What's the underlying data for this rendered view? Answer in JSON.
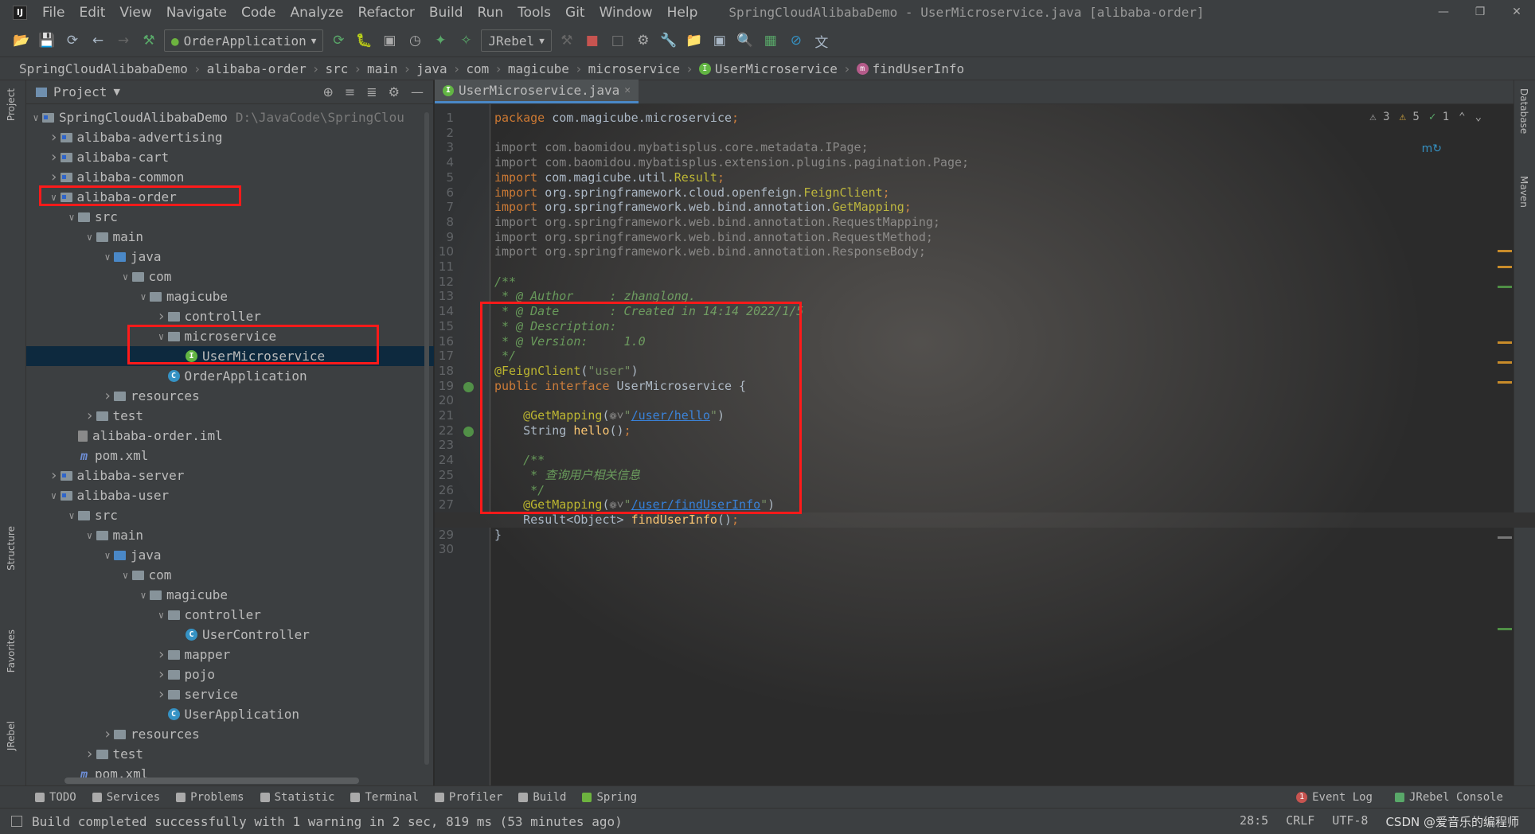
{
  "window": {
    "menu": [
      "File",
      "Edit",
      "View",
      "Navigate",
      "Code",
      "Analyze",
      "Refactor",
      "Build",
      "Run",
      "Tools",
      "Git",
      "Window",
      "Help"
    ],
    "title": "SpringCloudAlibabaDemo - UserMicroservice.java [alibaba-order]"
  },
  "toolbar": {
    "run_config": "OrderApplication",
    "jrebel": "JRebel"
  },
  "breadcrumb": [
    "SpringCloudAlibabaDemo",
    "alibaba-order",
    "src",
    "main",
    "java",
    "com",
    "magicube",
    "microservice",
    "UserMicroservice",
    "findUserInfo"
  ],
  "side_labels": {
    "project": "Project",
    "structure": "Structure",
    "favorites": "Favorites",
    "jrebel": "JRebel",
    "database": "Database",
    "maven": "Maven"
  },
  "project_panel": {
    "title": "Project",
    "root_path": "D:\\JavaCode\\SpringClou",
    "tree": [
      {
        "label": "SpringCloudAlibabaDemo",
        "depth": 0,
        "arrow": "v",
        "type": "module"
      },
      {
        "label": "alibaba-advertising",
        "depth": 1,
        "arrow": ">",
        "type": "module"
      },
      {
        "label": "alibaba-cart",
        "depth": 1,
        "arrow": ">",
        "type": "module"
      },
      {
        "label": "alibaba-common",
        "depth": 1,
        "arrow": ">",
        "type": "module"
      },
      {
        "label": "alibaba-order",
        "depth": 1,
        "arrow": "v",
        "type": "module"
      },
      {
        "label": "src",
        "depth": 2,
        "arrow": "v",
        "type": "folder"
      },
      {
        "label": "main",
        "depth": 3,
        "arrow": "v",
        "type": "folder"
      },
      {
        "label": "java",
        "depth": 4,
        "arrow": "v",
        "type": "srcfolder"
      },
      {
        "label": "com",
        "depth": 5,
        "arrow": "v",
        "type": "folder"
      },
      {
        "label": "magicube",
        "depth": 6,
        "arrow": "v",
        "type": "folder"
      },
      {
        "label": "controller",
        "depth": 7,
        "arrow": ">",
        "type": "folder"
      },
      {
        "label": "microservice",
        "depth": 7,
        "arrow": "v",
        "type": "folder"
      },
      {
        "label": "UserMicroservice",
        "depth": 8,
        "arrow": "",
        "type": "interface",
        "selected": true
      },
      {
        "label": "OrderApplication",
        "depth": 7,
        "arrow": "",
        "type": "springclass"
      },
      {
        "label": "resources",
        "depth": 4,
        "arrow": ">",
        "type": "folder"
      },
      {
        "label": "test",
        "depth": 3,
        "arrow": ">",
        "type": "folder"
      },
      {
        "label": "alibaba-order.iml",
        "depth": 2,
        "arrow": "",
        "type": "iml"
      },
      {
        "label": "pom.xml",
        "depth": 2,
        "arrow": "",
        "type": "maven"
      },
      {
        "label": "alibaba-server",
        "depth": 1,
        "arrow": ">",
        "type": "module"
      },
      {
        "label": "alibaba-user",
        "depth": 1,
        "arrow": "v",
        "type": "module"
      },
      {
        "label": "src",
        "depth": 2,
        "arrow": "v",
        "type": "folder"
      },
      {
        "label": "main",
        "depth": 3,
        "arrow": "v",
        "type": "folder"
      },
      {
        "label": "java",
        "depth": 4,
        "arrow": "v",
        "type": "srcfolder"
      },
      {
        "label": "com",
        "depth": 5,
        "arrow": "v",
        "type": "folder"
      },
      {
        "label": "magicube",
        "depth": 6,
        "arrow": "v",
        "type": "folder"
      },
      {
        "label": "controller",
        "depth": 7,
        "arrow": "v",
        "type": "folder"
      },
      {
        "label": "UserController",
        "depth": 8,
        "arrow": "",
        "type": "class"
      },
      {
        "label": "mapper",
        "depth": 7,
        "arrow": ">",
        "type": "folder"
      },
      {
        "label": "pojo",
        "depth": 7,
        "arrow": ">",
        "type": "folder"
      },
      {
        "label": "service",
        "depth": 7,
        "arrow": ">",
        "type": "folder"
      },
      {
        "label": "UserApplication",
        "depth": 7,
        "arrow": "",
        "type": "springclass"
      },
      {
        "label": "resources",
        "depth": 4,
        "arrow": ">",
        "type": "folder"
      },
      {
        "label": "test",
        "depth": 3,
        "arrow": ">",
        "type": "folder"
      },
      {
        "label": "pom.xml",
        "depth": 2,
        "arrow": "",
        "type": "maven"
      }
    ]
  },
  "editor": {
    "tab": "UserMicroservice.java",
    "inspections": {
      "warn_a": "3",
      "warn_b": "5",
      "ok": "1"
    },
    "current_line": 28,
    "lines": [
      [
        [
          "kw",
          "package "
        ],
        [
          "cls",
          "com.magicube.microservice"
        ],
        [
          "kw",
          ";"
        ]
      ],
      [],
      [
        [
          "gray",
          "import com.baomidou.mybatisplus.core.metadata.IPage;"
        ]
      ],
      [
        [
          "gray",
          "import com.baomidou.mybatisplus.extension.plugins.pagination.Page;"
        ]
      ],
      [
        [
          "kw",
          "import "
        ],
        [
          "cls",
          "com.magicube.util."
        ],
        [
          "ann",
          "Result"
        ],
        [
          "kw",
          ";"
        ]
      ],
      [
        [
          "kw",
          "import "
        ],
        [
          "cls",
          "org.springframework.cloud.openfeign."
        ],
        [
          "ann",
          "FeignClient"
        ],
        [
          "kw",
          ";"
        ]
      ],
      [
        [
          "kw",
          "import "
        ],
        [
          "cls",
          "org.springframework.web.bind.annotation."
        ],
        [
          "ann",
          "GetMapping"
        ],
        [
          "kw",
          ";"
        ]
      ],
      [
        [
          "gray",
          "import org.springframework.web.bind.annotation.RequestMapping;"
        ]
      ],
      [
        [
          "gray",
          "import org.springframework.web.bind.annotation.RequestMethod;"
        ]
      ],
      [
        [
          "gray",
          "import org.springframework.web.bind.annotation.ResponseBody;"
        ]
      ],
      [],
      [
        [
          "com",
          "/**"
        ]
      ],
      [
        [
          "com",
          " * @ Author     : "
        ],
        [
          "com",
          "zhanglong"
        ],
        [
          "com",
          "."
        ]
      ],
      [
        [
          "com",
          " * @ Date       : Created in 14:14 2022/1/5"
        ]
      ],
      [
        [
          "com",
          " * @ Description:"
        ]
      ],
      [
        [
          "com",
          " * @ Version:     1.0"
        ]
      ],
      [
        [
          "com",
          " */"
        ]
      ],
      [
        [
          "ann",
          "@FeignClient"
        ],
        [
          "cls",
          "("
        ],
        [
          "str",
          "\"user\""
        ],
        [
          "cls",
          ")"
        ]
      ],
      [
        [
          "kw",
          "public interface "
        ],
        [
          "cls",
          "UserMicroservice {"
        ]
      ],
      [],
      [
        [
          "ann",
          "    @GetMapping"
        ],
        [
          "cls",
          "("
        ],
        [
          "gray",
          "❁˅"
        ],
        [
          "str",
          "\""
        ],
        [
          "url",
          "/user/hello"
        ],
        [
          "str",
          "\""
        ],
        [
          "cls",
          ")"
        ]
      ],
      [
        [
          "cls",
          "    String "
        ],
        [
          "fn",
          "hello"
        ],
        [
          "cls",
          "()"
        ],
        [
          "kw",
          ";"
        ]
      ],
      [],
      [
        [
          "com",
          "    /**"
        ]
      ],
      [
        [
          "com",
          "     * 查询用户相关信息"
        ]
      ],
      [
        [
          "com",
          "     */"
        ]
      ],
      [
        [
          "ann",
          "    @GetMapping"
        ],
        [
          "cls",
          "("
        ],
        [
          "gray",
          "❁˅"
        ],
        [
          "str",
          "\""
        ],
        [
          "url",
          "/user/findUserInfo"
        ],
        [
          "str",
          "\""
        ],
        [
          "cls",
          ")"
        ]
      ],
      [
        [
          "cls",
          "    Result<Object> "
        ],
        [
          "fn",
          "findUserInfo"
        ],
        [
          "cls",
          "()"
        ],
        [
          "kw",
          ";"
        ]
      ],
      [
        [
          "cls",
          "}"
        ]
      ],
      []
    ]
  },
  "bottom_tools": [
    "TODO",
    "Services",
    "Problems",
    "Statistic",
    "Terminal",
    "Profiler",
    "Build",
    "Spring"
  ],
  "bottom_right": {
    "event_log": "Event Log",
    "event_count": "1",
    "jrebel_console": "JRebel Console"
  },
  "status": {
    "message": "Build completed successfully with 1 warning in 2 sec, 819 ms (53 minutes ago)",
    "position": "28:5",
    "line_sep": "CRLF",
    "encoding": "UTF-8",
    "watermark": "CSDN @爱音乐的编程师"
  },
  "colors": {
    "highlight_box": "#ff1a1a",
    "selection": "#0d293e",
    "keyword": "#cc7832",
    "string": "#6a8759",
    "annotation": "#bbb529"
  }
}
